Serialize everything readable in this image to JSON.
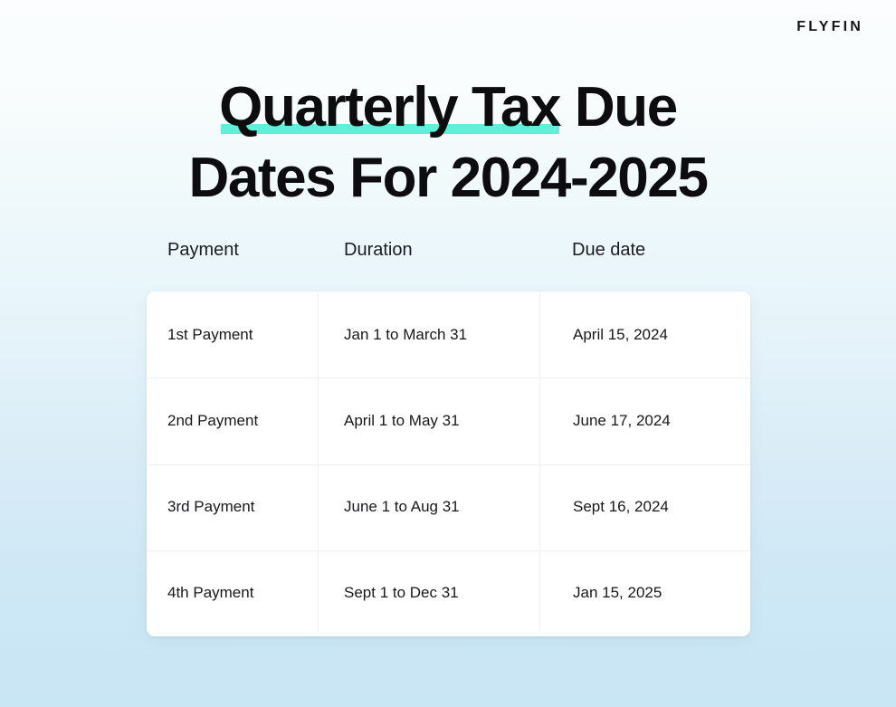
{
  "brand": {
    "name": "FLYFIN"
  },
  "title": {
    "line1_highlighted": "Quarterly Tax",
    "line1_rest": " Due",
    "line2": "Dates For 2024-2025",
    "full": "Quarterly Tax Due Dates For 2024-2025",
    "highlight_color": "#5ff0dc"
  },
  "table": {
    "headers": [
      "Payment",
      "Duration",
      "Due date"
    ],
    "rows": [
      {
        "payment": "1st Payment",
        "duration": "Jan 1 to March 31",
        "due_date": "April 15, 2024"
      },
      {
        "payment": "2nd Payment",
        "duration": "April 1 to May 31",
        "due_date": "June 17, 2024"
      },
      {
        "payment": "3rd Payment",
        "duration": "June 1 to Aug 31",
        "due_date": "Sept 16, 2024"
      },
      {
        "payment": "4th Payment",
        "duration": "Sept 1 to Dec 31",
        "due_date": "Jan 15, 2025"
      }
    ]
  },
  "theme": {
    "background_top": "#fbfdfe",
    "background_bottom": "#c9e6f4",
    "card_background": "#ffffff",
    "divider": "#eff0f2",
    "text": "#17181b"
  }
}
